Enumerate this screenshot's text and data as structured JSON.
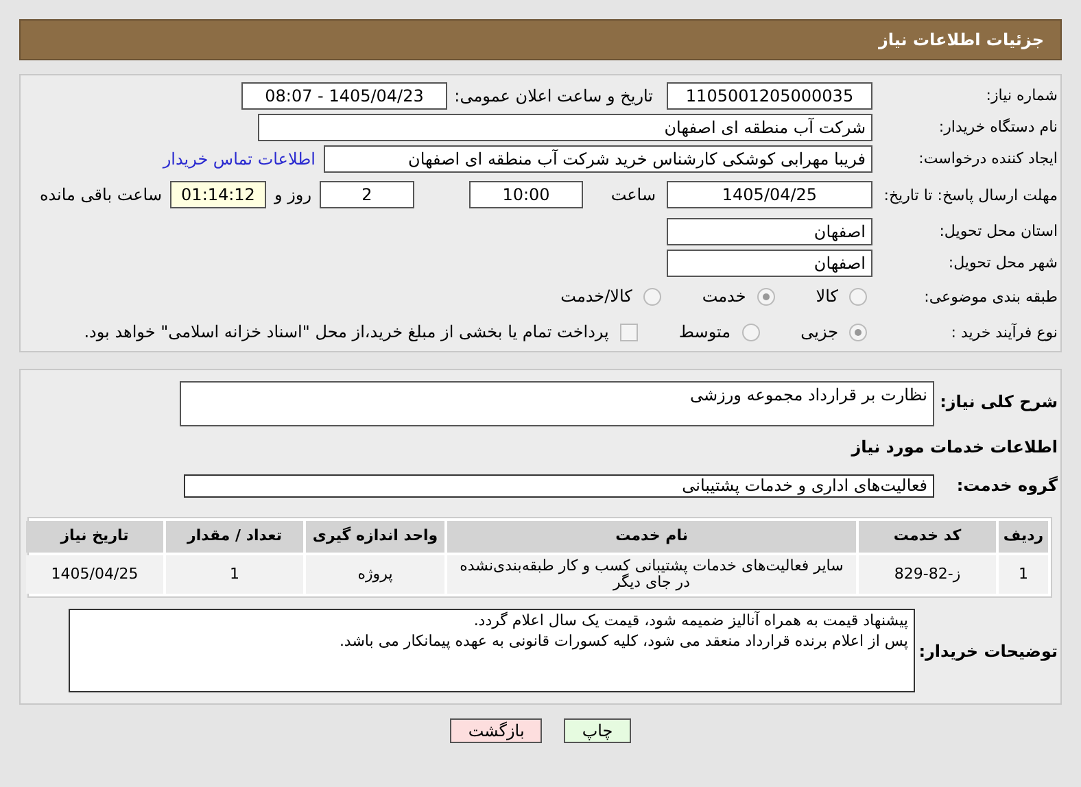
{
  "header": {
    "title": "جزئیات اطلاعات نیاز"
  },
  "need_number": {
    "label": "شماره نیاز:",
    "value": "1105001205000035"
  },
  "announce": {
    "label": "تاریخ و ساعت اعلان عمومی:",
    "value": "1405/04/23 - 08:07"
  },
  "buyer_org": {
    "label": "نام دستگاه خریدار:",
    "value": "شرکت آب منطقه ای اصفهان"
  },
  "creator": {
    "label": "ایجاد کننده درخواست:",
    "value": "فریبا مهرابی کوشکی کارشناس خرید شرکت آب منطقه ای اصفهان",
    "link": "اطلاعات تماس خریدار"
  },
  "deadline": {
    "label": "مهلت ارسال پاسخ: تا تاریخ:",
    "date": "1405/04/25",
    "time_label": "ساعت",
    "time": "10:00",
    "days": "2",
    "days_label": "روز و",
    "remaining": "01:14:12",
    "remaining_label": "ساعت باقی مانده"
  },
  "province": {
    "label": "استان محل تحویل:",
    "value": "اصفهان"
  },
  "city": {
    "label": "شهر محل تحویل:",
    "value": "اصفهان"
  },
  "category": {
    "label": "طبقه بندی موضوعی:",
    "options": [
      {
        "label": "کالا",
        "selected": false
      },
      {
        "label": "خدمت",
        "selected": true
      },
      {
        "label": "کالا/خدمت",
        "selected": false
      }
    ]
  },
  "purchase_type": {
    "label": "نوع فرآیند خرید :",
    "options": [
      {
        "label": "جزیی",
        "selected": true
      },
      {
        "label": "متوسط",
        "selected": false
      }
    ],
    "payment": {
      "checked": false,
      "text": "پرداخت تمام یا بخشی از مبلغ خرید،از محل \"اسناد خزانه اسلامی\" خواهد بود."
    }
  },
  "description": {
    "label": "شرح کلی نیاز:",
    "value": "نظارت بر قرارداد مجموعه ورزشی"
  },
  "services_heading": "اطلاعات خدمات مورد نیاز",
  "service_group": {
    "label": "گروه خدمت:",
    "value": "فعالیت‌های اداری و خدمات پشتیبانی"
  },
  "table": {
    "columns": [
      "ردیف",
      "کد خدمت",
      "نام خدمت",
      "واحد اندازه گیری",
      "تعداد / مقدار",
      "تاریخ نیاز"
    ],
    "rows": [
      [
        "1",
        "ز-82-829",
        "سایر فعالیت‌های خدمات پشتیبانی کسب و کار طبقه‌بندی‌نشده در جای دیگر",
        "پروژه",
        "1",
        "1405/04/25"
      ]
    ]
  },
  "buyer_notes": {
    "label": "توضیحات خریدار:",
    "lines": [
      "پیشنهاد قیمت به همراه آنالیز ضمیمه شود، قیمت یک سال اعلام گردد.",
      "پس از اعلام برنده قرارداد منعقد می شود، کلیه کسورات قانونی به عهده پیمانکار می باشد."
    ]
  },
  "buttons": [
    {
      "label": "چاپ",
      "kind": "print"
    },
    {
      "label": "بازگشت",
      "kind": "back"
    }
  ]
}
